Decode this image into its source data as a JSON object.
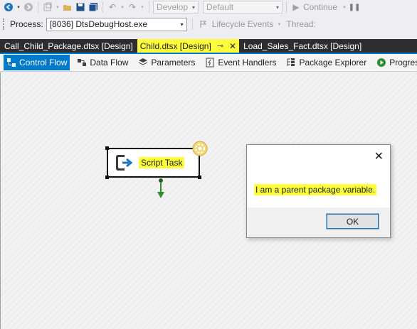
{
  "toolbar": {
    "config_combo": "Develop",
    "platform_combo": "Default",
    "continue_label": "Continue"
  },
  "debug_bar": {
    "process_label": "Process:",
    "process_value": "[8036] DtsDebugHost.exe",
    "lifecycle_label": "Lifecycle Events",
    "thread_label": "Thread:"
  },
  "tabs": [
    {
      "label": "Call_Child_Package.dtsx [Design]"
    },
    {
      "label": "Child.dtsx [Design]"
    },
    {
      "label": "Load_Sales_Fact.dtsx [Design]"
    }
  ],
  "designer_tabs": [
    {
      "label": "Control Flow"
    },
    {
      "label": "Data Flow"
    },
    {
      "label": "Parameters"
    },
    {
      "label": "Event Handlers"
    },
    {
      "label": "Package Explorer"
    },
    {
      "label": "Progress"
    }
  ],
  "task": {
    "label": "Script Task"
  },
  "dialog": {
    "message": "I am a parent package variable.",
    "ok_label": "OK"
  },
  "colors": {
    "accent": "#007acc",
    "highlight": "#fdfd3b",
    "tab_bar": "#2d2d30",
    "connector": "#2f8f2f"
  }
}
